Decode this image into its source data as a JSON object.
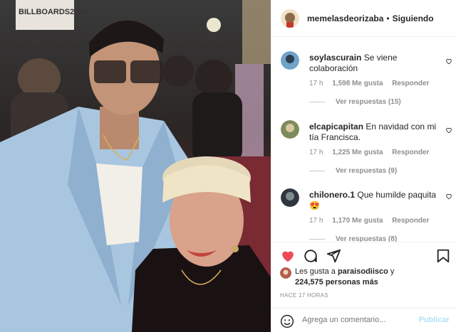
{
  "post": {
    "username": "memelasdeorizaba",
    "follow_status": "Siguiendo",
    "photo_sign_text": "BILLBOARDS2021"
  },
  "comments": [
    {
      "username": "soylascurain",
      "text": "Se viene colaboración",
      "time": "17 h",
      "likes": "1,598 Me gusta",
      "reply_label": "Responder",
      "replies_label": "Ver respuestas (15)"
    },
    {
      "username": "elcapicapitan",
      "text": "En navidad con mi tía Francisca.",
      "time": "17 h",
      "likes": "1,225 Me gusta",
      "reply_label": "Responder",
      "replies_label": "Ver respuestas (9)"
    },
    {
      "username": "chilonero.1",
      "text": "Que humilde paquita 😍",
      "time": "17 h",
      "likes": "1,170 Me gusta",
      "reply_label": "Responder",
      "replies_label": "Ver respuestas (8)"
    }
  ],
  "likes_summary": {
    "prefix": "Les gusta a",
    "liker": "paraisodiisco",
    "connector": "y",
    "others": "224,575 personas más"
  },
  "timestamp": "HACE 17 HORAS",
  "add_comment": {
    "placeholder": "Agrega un comentario...",
    "publish_label": "Publicar"
  },
  "icons": {
    "like": "heart-filled-icon",
    "comment": "comment-bubble-icon",
    "share": "paper-plane-icon",
    "save": "bookmark-icon",
    "emoji": "smiley-icon",
    "comment_like": "heart-outline-icon"
  },
  "colors": {
    "like_red": "#ed4956",
    "meta_gray": "#8e8e8e",
    "publish_blue": "#b2dffc",
    "text": "#262626"
  }
}
